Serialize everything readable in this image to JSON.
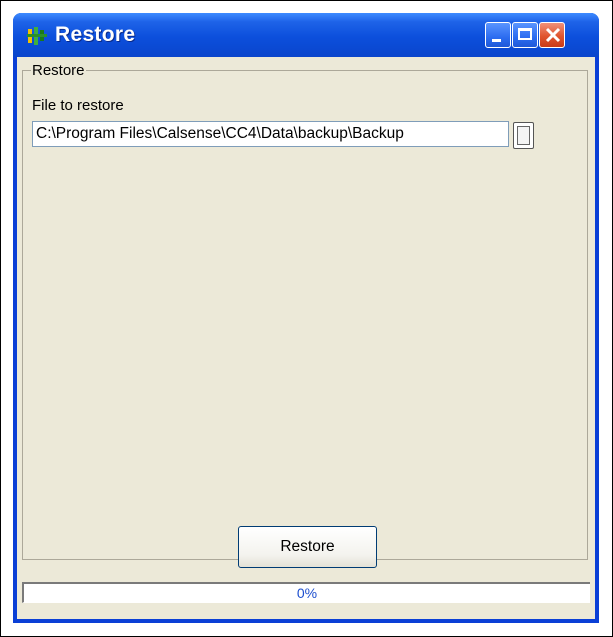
{
  "window": {
    "title": "Restore",
    "icon": "app-icon",
    "controls": [
      "minimize-icon",
      "maximize-icon",
      "close-icon"
    ]
  },
  "group": {
    "label": "Restore"
  },
  "file": {
    "label": "File to restore",
    "value": "C:\\Program Files\\Calsense\\CC4\\Data\\backup\\Backup"
  },
  "actions": {
    "restore_label": "Restore"
  },
  "progress": {
    "fraction": 0.0,
    "label": "0%"
  },
  "colors": {
    "titlebar": "#0a45cc",
    "face": "#ece9d8",
    "progress_text": "#1d4fcf"
  }
}
